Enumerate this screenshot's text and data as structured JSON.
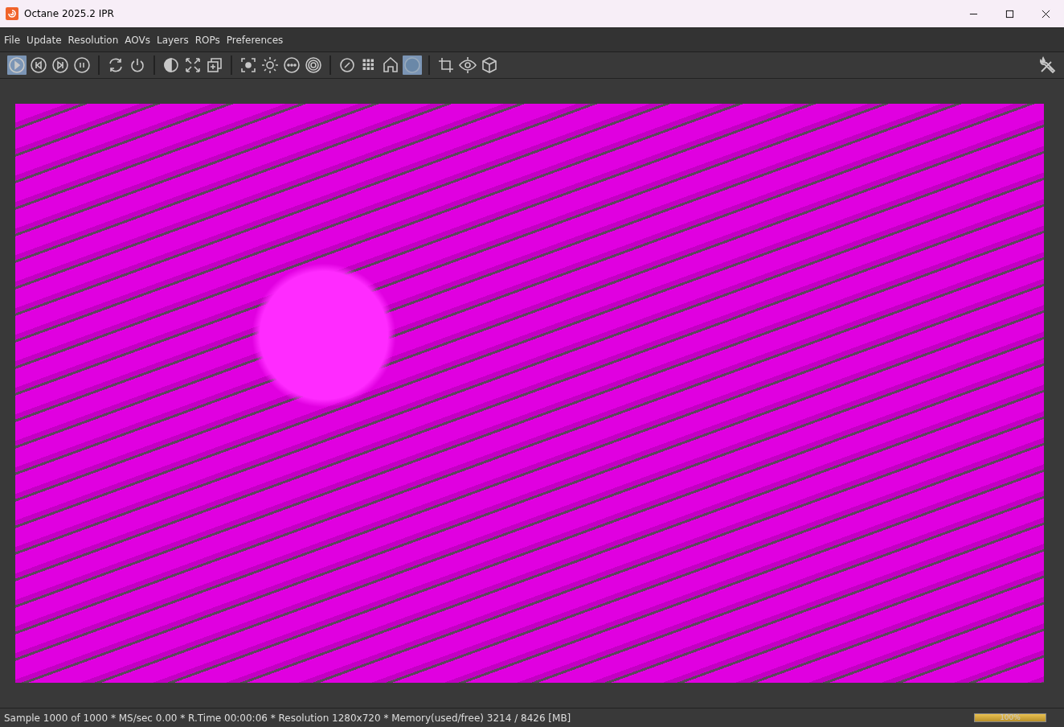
{
  "window": {
    "title": "Octane 2025.2 IPR"
  },
  "menu": [
    "File",
    "Update",
    "Resolution",
    "AOVs",
    "Layers",
    "ROPs",
    "Preferences"
  ],
  "toolbar": [
    [
      {
        "kind": "play",
        "selected": true
      },
      {
        "kind": "prev",
        "selected": false
      },
      {
        "kind": "next",
        "selected": false
      },
      {
        "kind": "pause",
        "selected": false
      }
    ],
    [
      {
        "kind": "refresh",
        "selected": false
      },
      {
        "kind": "power",
        "selected": false
      }
    ],
    [
      {
        "kind": "contrast",
        "selected": false
      },
      {
        "kind": "expand",
        "selected": false
      },
      {
        "kind": "copy",
        "selected": false
      }
    ],
    [
      {
        "kind": "focus",
        "selected": false
      },
      {
        "kind": "sun",
        "selected": false
      },
      {
        "kind": "dots",
        "selected": false
      },
      {
        "kind": "target",
        "selected": false
      }
    ],
    [
      {
        "kind": "dial",
        "selected": false
      },
      {
        "kind": "grid",
        "selected": false
      },
      {
        "kind": "home",
        "selected": false
      },
      {
        "kind": "sphere",
        "selected": true
      }
    ],
    [
      {
        "kind": "crop",
        "selected": false
      },
      {
        "kind": "eye",
        "selected": false
      },
      {
        "kind": "cube",
        "selected": false
      }
    ]
  ],
  "status_bar": {
    "text": "Sample 1000 of 1000 * MS/sec 0.00 * R.Time 00:00:06 * Resolution 1280x720 * Memory(used/free) 3214 / 8426 [MB]",
    "progress": {
      "level": 1,
      "label": "100%"
    }
  }
}
